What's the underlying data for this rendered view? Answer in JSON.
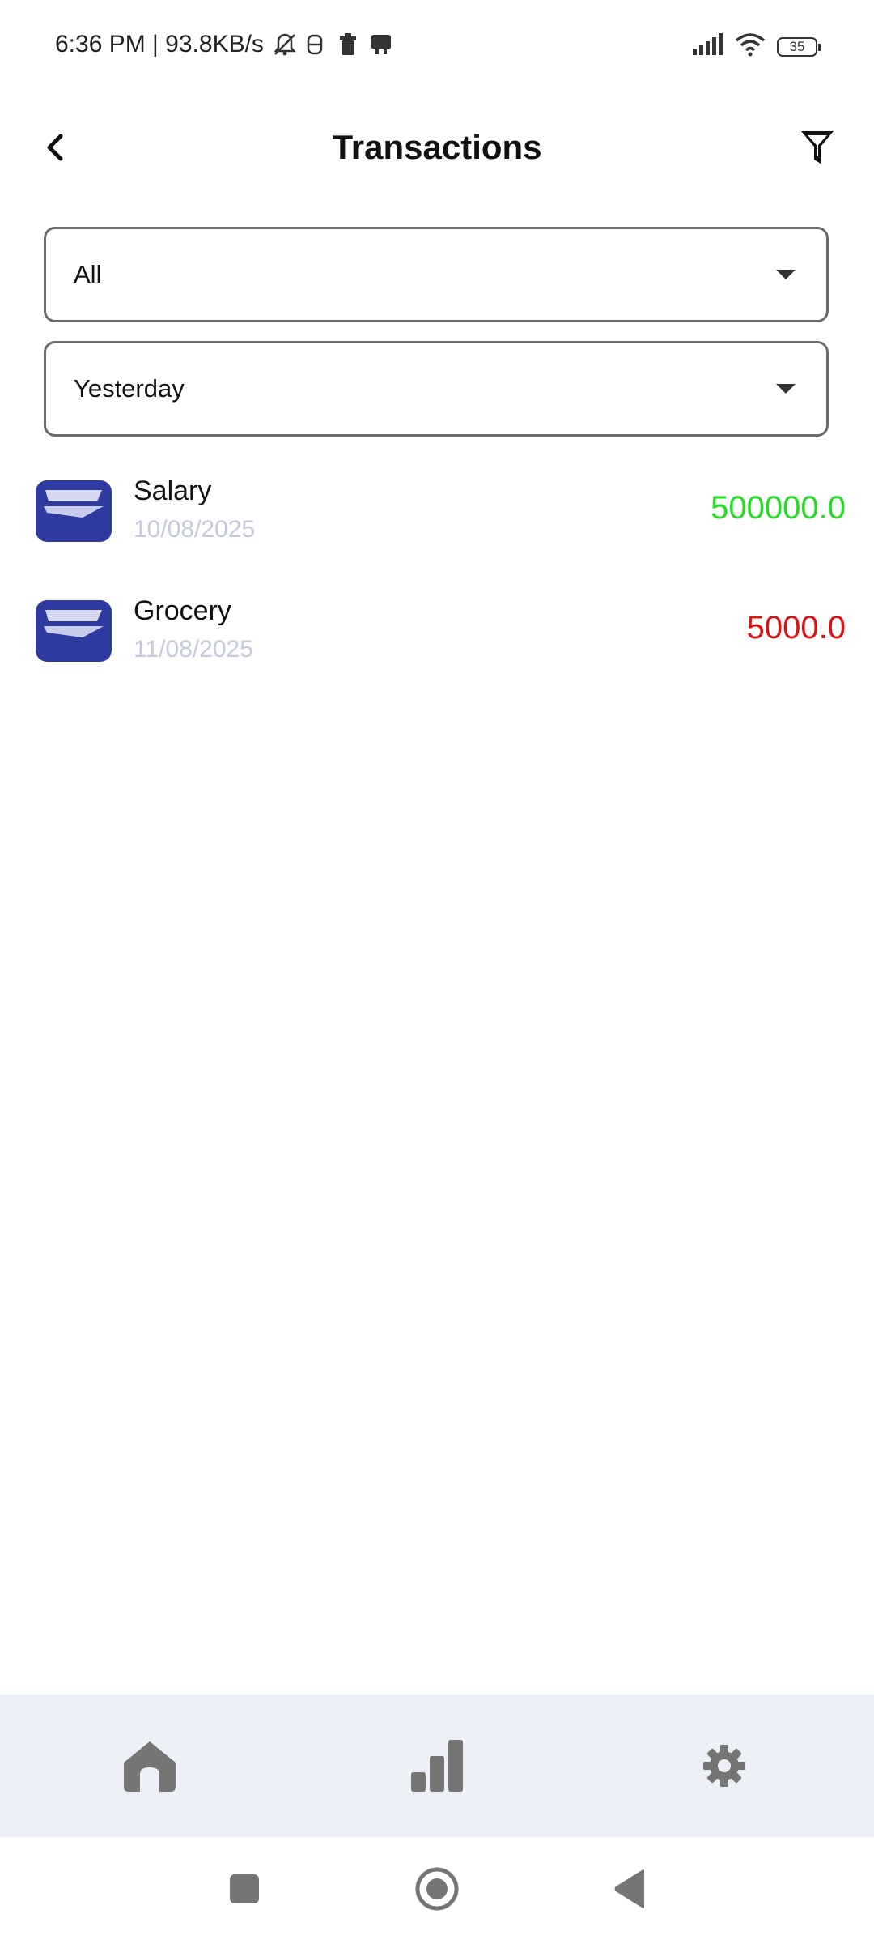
{
  "status_bar": {
    "time_speed": "6:36 PM | 93.8KB/s",
    "battery": "35"
  },
  "header": {
    "title": "Transactions"
  },
  "filters": {
    "type_value": "All",
    "date_value": "Yesterday"
  },
  "transactions": [
    {
      "title": "Salary",
      "date": "10/08/2025",
      "amount": "500000.0",
      "kind": "income",
      "color": "#22dd22"
    },
    {
      "title": "Grocery",
      "date": "11/08/2025",
      "amount": "5000.0",
      "kind": "expense",
      "color": "#dd1111"
    }
  ],
  "bottom_nav": {
    "items": [
      {
        "icon": "home-icon"
      },
      {
        "icon": "bar-chart-icon"
      },
      {
        "icon": "gear-icon"
      }
    ]
  },
  "system_nav": {
    "items": [
      {
        "icon": "recents-square-icon"
      },
      {
        "icon": "home-circle-icon"
      },
      {
        "icon": "back-triangle-icon"
      }
    ]
  },
  "colors": {
    "accent": "#2e3aa0",
    "income": "#22dd22",
    "expense": "#dd1111",
    "date_text": "#c4c9dc",
    "nav_background": "#eef0f8",
    "nav_icon": "#757575"
  }
}
